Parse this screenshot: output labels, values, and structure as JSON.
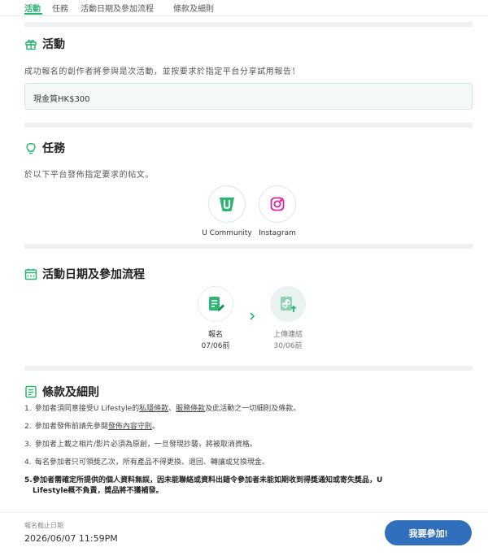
{
  "tabs": {
    "activity": "活動",
    "mission": "任務",
    "schedule": "活動日期及參加流程",
    "terms": "條款及細則"
  },
  "activity": {
    "title": "活動",
    "description": "成功報名的創作者將參與是次活動，並按要求於指定平台分享試用報告！",
    "prize": "現金筫HK$300"
  },
  "mission": {
    "title": "任務",
    "description": "於以下平台發佈指定要求的帖文。",
    "platforms": [
      {
        "label": "U Community",
        "icon": "u-community-icon",
        "color": "#2bb673"
      },
      {
        "label": "Instagram",
        "icon": "instagram-icon",
        "color": "#d6249f"
      }
    ]
  },
  "schedule": {
    "title": "活動日期及參加流程",
    "steps": [
      {
        "label": "報名",
        "date": "07/06前",
        "icon": "register-icon"
      },
      {
        "label": "上傳連結",
        "date": "30/06前",
        "icon": "upload-link-icon"
      }
    ]
  },
  "terms": {
    "title": "條款及細則",
    "items": [
      {
        "num": "1.",
        "before": "參加者須同意接受U Lifestyle的",
        "link1": "私隱條款",
        "sep": "、",
        "link2": "服務條款",
        "after": "及此活動之一切細則及條款。"
      },
      {
        "num": "2.",
        "before": "參加者發佈前請先參閱",
        "link1": "發佈內容守則",
        "after": "。"
      },
      {
        "num": "3.",
        "text": "參加者上載之相片/影片必須為原創，一旦發現抄襲，將被取消資格。"
      },
      {
        "num": "4.",
        "text": "每名參加者只可領獎乙次，所有產品不得更換、退回、轉讓或兌換現金。"
      },
      {
        "num": "5.",
        "line1": "參加者需確定所提供的個人資料無誤，因未能聯絡或資料出錯令參加者未能如期收到得獎通知或寄失獎品，U",
        "line2": "Lifestyle概不負責，獎品將不獲補發。"
      }
    ]
  },
  "footer": {
    "deadline_label": "報名截止日期",
    "deadline_value": "2026/06/07 11:59PM",
    "join_label": "我要參加!"
  },
  "colors": {
    "accent": "#2bb673",
    "button": "#2f6fbc",
    "divider": "#eef0f1"
  }
}
